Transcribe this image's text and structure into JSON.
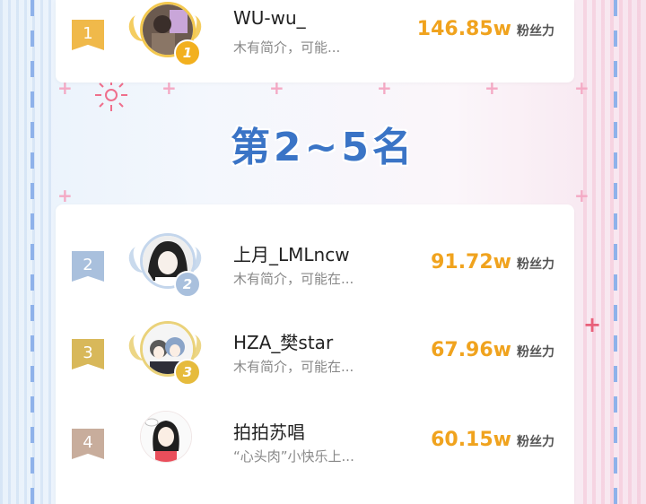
{
  "section_title": "第2~5名",
  "fans_unit": "粉丝力",
  "rankings": [
    {
      "rank": "1",
      "name": "WU-wu_",
      "description": "木有简介，可能...",
      "fans": "146.85w",
      "coin": "1"
    },
    {
      "rank": "2",
      "name": "上月_LMLncw",
      "description": "木有简介，可能在...",
      "fans": "91.72w",
      "coin": "2"
    },
    {
      "rank": "3",
      "name": "HZA_樊star",
      "description": "木有简介，可能在...",
      "fans": "67.96w",
      "coin": "3"
    },
    {
      "rank": "4",
      "name": "拍拍苏唱",
      "description": "“心头肉”小快乐上...",
      "fans": "60.15w",
      "coin": ""
    }
  ],
  "colors": {
    "gold": "#f0b94a",
    "silver": "#a9c0dd",
    "bronze": "#d8b85a",
    "fourth": "#c8ad9c",
    "accent_number": "#f0a31e",
    "title": "#3a74c6"
  }
}
